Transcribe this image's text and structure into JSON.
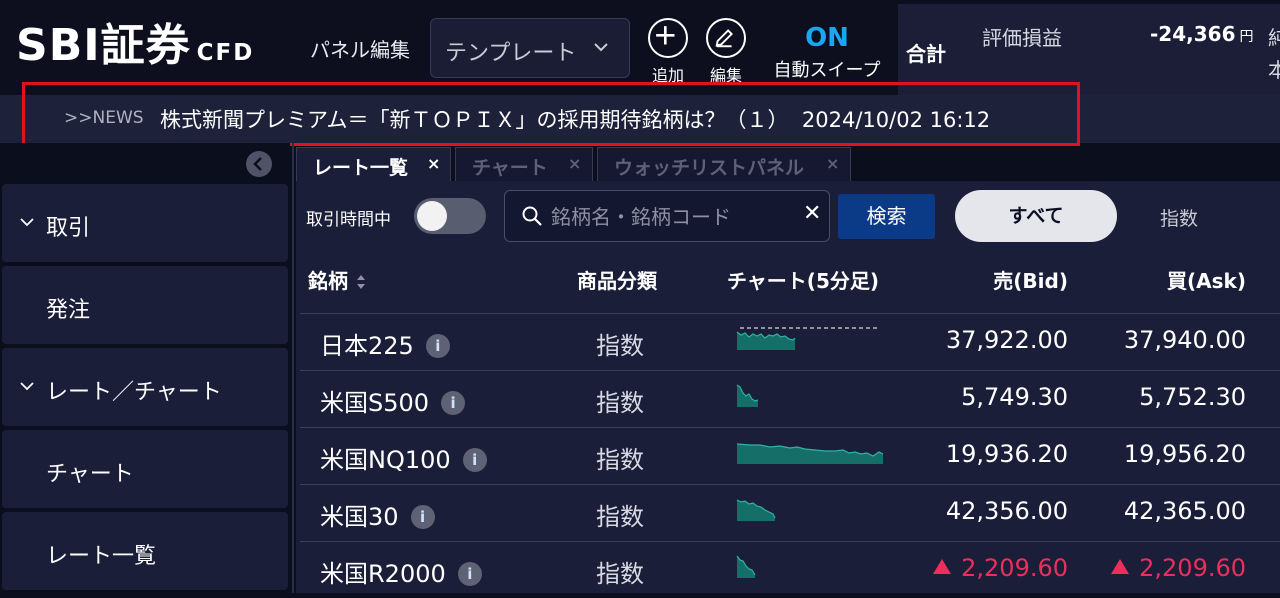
{
  "header": {
    "logo_main": "SBI証券",
    "logo_sub": "CFD",
    "panel_edit_label": "パネル編集",
    "template_select": "テンプレート",
    "add_label": "追加",
    "edit_label": "編集",
    "auto_sweep_status": "ON",
    "auto_sweep_label": "自動スイープ"
  },
  "summary": {
    "total_label": "合計",
    "pl_label": "評価損益",
    "pl_value": "-24,366",
    "pl_unit": "円",
    "cut_label_1": "純",
    "cut_label_2": "本"
  },
  "news": {
    "prefix": ">>NEWS",
    "headline": "株式新聞プレミアム＝「新ＴＯＰＩＸ」の採用期待銘柄は？（１）",
    "timestamp": "2024/10/02 16:12"
  },
  "sidebar": {
    "items": [
      {
        "label": "取引",
        "expandable": true
      },
      {
        "label": "発注",
        "expandable": false
      },
      {
        "label": "レート／チャート",
        "expandable": true
      },
      {
        "label": "チャート",
        "expandable": false
      },
      {
        "label": "レート一覧",
        "expandable": false
      }
    ]
  },
  "tabs": [
    {
      "label": "レート一覧",
      "active": true
    },
    {
      "label": "チャート",
      "active": false
    },
    {
      "label": "ウォッチリストパネル",
      "active": false
    }
  ],
  "filters": {
    "trading_hours_label": "取引時間中",
    "trading_hours_on": false,
    "search_placeholder": "銘柄名・銘柄コード",
    "search_button": "検索",
    "all_label": "すべて",
    "index_label": "指数"
  },
  "table": {
    "headers": {
      "symbol": "銘柄",
      "category": "商品分類",
      "chart": "チャート(5分足)",
      "bid": "売(Bid)",
      "ask": "買(Ask)"
    },
    "rows": [
      {
        "name": "日本225",
        "category": "指数",
        "bid": "37,922.00",
        "ask": "37,940.00",
        "up": false
      },
      {
        "name": "米国S500",
        "category": "指数",
        "bid": "5,749.30",
        "ask": "5,752.30",
        "up": false
      },
      {
        "name": "米国NQ100",
        "category": "指数",
        "bid": "19,936.20",
        "ask": "19,956.20",
        "up": false
      },
      {
        "name": "米国30",
        "category": "指数",
        "bid": "42,356.00",
        "ask": "42,365.00",
        "up": false
      },
      {
        "name": "米国R2000",
        "category": "指数",
        "bid": "2,209.60",
        "ask": "2,209.60",
        "up": true
      }
    ]
  },
  "colors": {
    "accent_blue": "#19a7f4",
    "search_button": "#0b3a86",
    "price_up": "#ec2e5c",
    "sparkline": "#1e9a8c",
    "highlight_frame": "#e3101d"
  }
}
